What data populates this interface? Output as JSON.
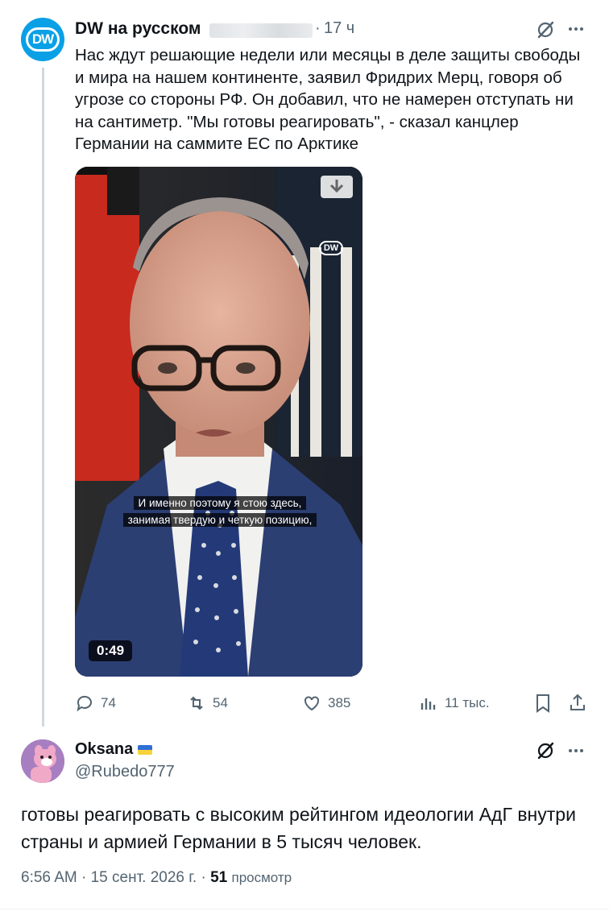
{
  "parent_tweet": {
    "author_name": "DW на русском",
    "avatar_text": "DW",
    "dot": "·",
    "time": "17 ч",
    "text": "Нас ждут решающие недели или месяцы в деле защиты свободы и мира на нашем континенте, заявил Фридрих Мерц, говоря об угрозе со стороны РФ. Он добавил, что не намерен отступать ни на сантиметр. \"Мы готовы реагировать\", - сказал канцлер Германии на саммите ЕС по Арктике",
    "video": {
      "watermark": "DW",
      "subtitle_line1": "И именно поэтому я стою здесь,",
      "subtitle_line2": "занимая твердую и четкую позицию,",
      "duration": "0:49"
    },
    "actions": {
      "replies": "74",
      "reposts": "54",
      "likes": "385",
      "views": "11 тыс."
    },
    "icons": [
      "grok-icon",
      "more-icon",
      "download-icon",
      "reply-icon",
      "repost-icon",
      "like-icon",
      "views-icon",
      "bookmark-icon",
      "share-icon"
    ]
  },
  "reply_tweet": {
    "author_name": "Oksana",
    "handle": "@Rubedo777",
    "text": "готовы реагировать с высоким рейтингом идеологии АдГ внутри страны и армией Германии в 5 тысяч человек.",
    "time": "6:56 AM",
    "date": "15 сент. 2026 г.",
    "dot": "·",
    "views_count": "51",
    "views_label": "просмотр"
  },
  "colors": {
    "dw_blue": "#0aa0e6",
    "secondary_text": "#536471",
    "primary_text": "#0f1419",
    "thread_line": "#cfd9de"
  }
}
